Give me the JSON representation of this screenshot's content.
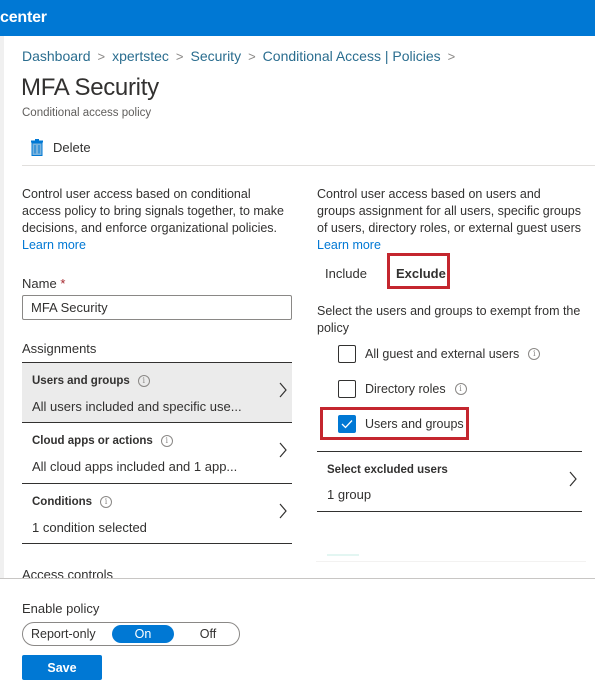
{
  "header": {
    "title": "center"
  },
  "breadcrumb": {
    "items": [
      "Dashboard",
      "xpertstec",
      "Security",
      "Conditional Access | Policies"
    ],
    "separator": ">"
  },
  "page": {
    "title": "MFA Security",
    "subtitle": "Conditional access policy"
  },
  "toolbar": {
    "delete_label": "Delete",
    "delete_icon": "trash-icon"
  },
  "left": {
    "description": "Control user access based on conditional access policy to bring signals together, to make decisions, and enforce organizational policies.",
    "learn_more": "Learn more",
    "name_label": "Name",
    "name_required": "*",
    "name_value": "MFA Security",
    "assignments_label": "Assignments",
    "assignments": [
      {
        "title": "Users and groups",
        "summary": "All users included and specific use...",
        "selected": true
      },
      {
        "title": "Cloud apps or actions",
        "summary": "All cloud apps included and 1 app...",
        "selected": false
      },
      {
        "title": "Conditions",
        "summary": "1 condition selected",
        "selected": false
      }
    ],
    "access_controls_label": "Access controls"
  },
  "right": {
    "description": "Control user access based on users and groups assignment for all users, specific groups of users, directory roles, or external guest users",
    "learn_more": "Learn more",
    "tabs": [
      {
        "label": "Include",
        "active": false
      },
      {
        "label": "Exclude",
        "active": true
      }
    ],
    "exempt_description": "Select the users and groups to exempt from the policy",
    "checkboxes": [
      {
        "label": "All guest and external users",
        "checked": false,
        "info": true
      },
      {
        "label": "Directory roles",
        "checked": false,
        "info": true
      },
      {
        "label": "Users and groups",
        "checked": true,
        "info": false
      }
    ],
    "excluded_users": {
      "title": "Select excluded users",
      "value": "1 group"
    }
  },
  "footer": {
    "enable_policy_label": "Enable policy",
    "toggle_options": [
      "Report-only",
      "On",
      "Off"
    ],
    "toggle_selected": "On",
    "save_label": "Save"
  },
  "colors": {
    "accent": "#0078d4",
    "highlight_box": "#c4262e",
    "selected_row": "#ebebeb"
  }
}
